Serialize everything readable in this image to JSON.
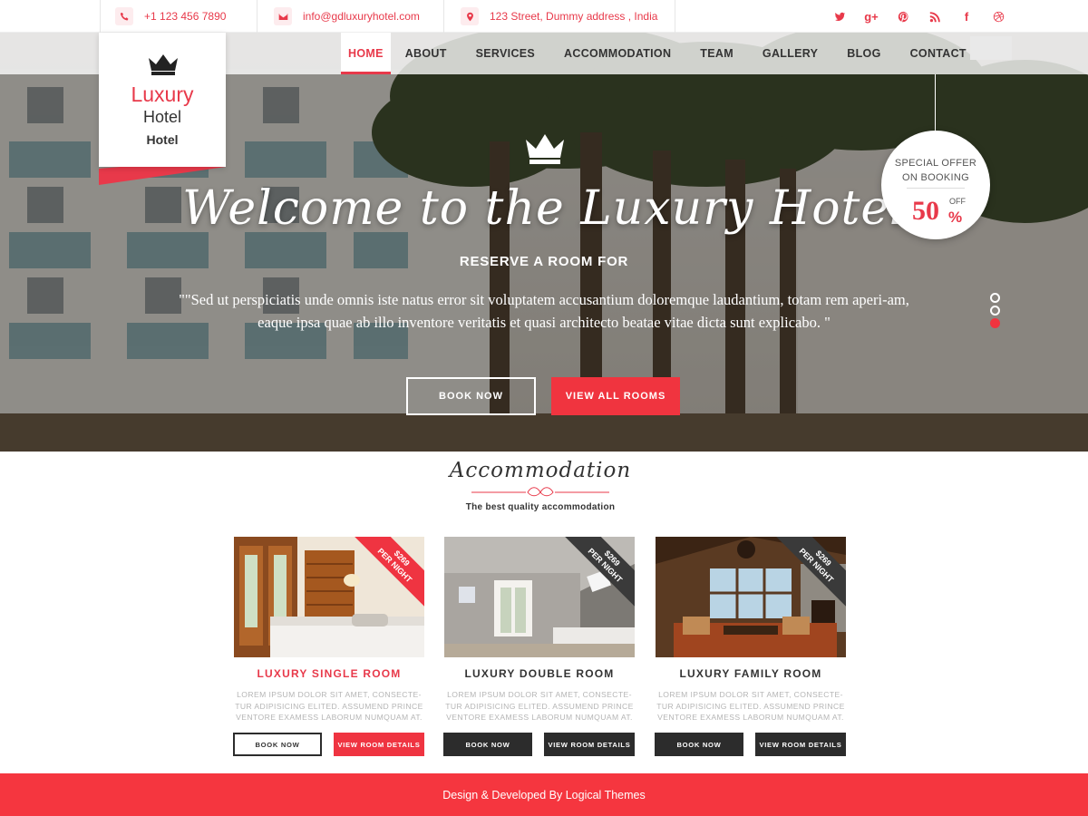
{
  "topbar": {
    "phone": "+1 123 456 7890",
    "email": "info@gdluxuryhotel.com",
    "address": "123 Street, Dummy address , India",
    "social": [
      {
        "icon": "twitter-icon",
        "glyph": ""
      },
      {
        "icon": "google-plus-icon",
        "glyph": "g+"
      },
      {
        "icon": "pinterest-icon",
        "glyph": ""
      },
      {
        "icon": "rss-icon",
        "glyph": ""
      },
      {
        "icon": "facebook-icon",
        "glyph": "f"
      },
      {
        "icon": "dribbble-icon",
        "glyph": ""
      }
    ]
  },
  "logo": {
    "line1": "Luxury",
    "line2": "Hotel",
    "line3": "Hotel"
  },
  "nav": {
    "items": [
      {
        "label": "HOME",
        "active": true
      },
      {
        "label": "ABOUT"
      },
      {
        "label": "SERVICES"
      },
      {
        "label": "ACCOMMODATION"
      },
      {
        "label": "TEAM"
      },
      {
        "label": "GALLERY"
      },
      {
        "label": "BLOG"
      },
      {
        "label": "CONTACT"
      }
    ]
  },
  "hero": {
    "title": "Welcome to the Luxury Hotel",
    "subtitle": "RESERVE A ROOM FOR",
    "text": "\"\"Sed ut perspiciatis unde omnis iste natus error sit voluptatem accusantium doloremque laudantium, totam rem aperi-am, eaque ipsa quae ab illo inventore veritatis et quasi architecto beatae vitae dicta sunt explicabo. \"",
    "book_label": "BOOK NOW",
    "rooms_label": "VIEW ALL ROOMS",
    "slides": 3,
    "active_slide": 3
  },
  "offer": {
    "line1": "SPECIAL OFFER",
    "line2": "ON BOOKING",
    "value": "50",
    "off": "OFF",
    "percent": "%"
  },
  "accommodation": {
    "title": "Accommodation",
    "subtitle": "The best quality accommodation",
    "rooms": [
      {
        "name": "LUXURY SINGLE ROOM",
        "price": "$269",
        "per": "PER NIGHT",
        "desc": "LOREM IPSUM DOLOR SIT AMET, CONSECTE-TUR ADIPISICING ELITED. ASSUMEND PRINCE VENTORE EXAMESS LABORUM NUMQUAM AT.",
        "book_label": "BOOK NOW",
        "details_label": "VIEW ROOM DETAILS"
      },
      {
        "name": "LUXURY DOUBLE ROOM",
        "price": "$269",
        "per": "PER NIGHT",
        "desc": "LOREM IPSUM DOLOR SIT AMET, CONSECTE-TUR ADIPISICING ELITED. ASSUMEND PRINCE VENTORE EXAMESS LABORUM NUMQUAM AT.",
        "book_label": "BOOK NOW",
        "details_label": "VIEW ROOM DETAILS"
      },
      {
        "name": "LUXURY FAMILY ROOM",
        "price": "$269",
        "per": "PER NIGHT",
        "desc": "LOREM IPSUM DOLOR SIT AMET, CONSECTE-TUR ADIPISICING ELITED. ASSUMEND PRINCE VENTORE EXAMESS LABORUM NUMQUAM AT.",
        "book_label": "BOOK NOW",
        "details_label": "VIEW ROOM DETAILS"
      }
    ]
  },
  "footer": {
    "text": "Design & Developed By Logical Themes"
  },
  "colors": {
    "accent": "#f0343f",
    "dark": "#2c2c2c"
  }
}
